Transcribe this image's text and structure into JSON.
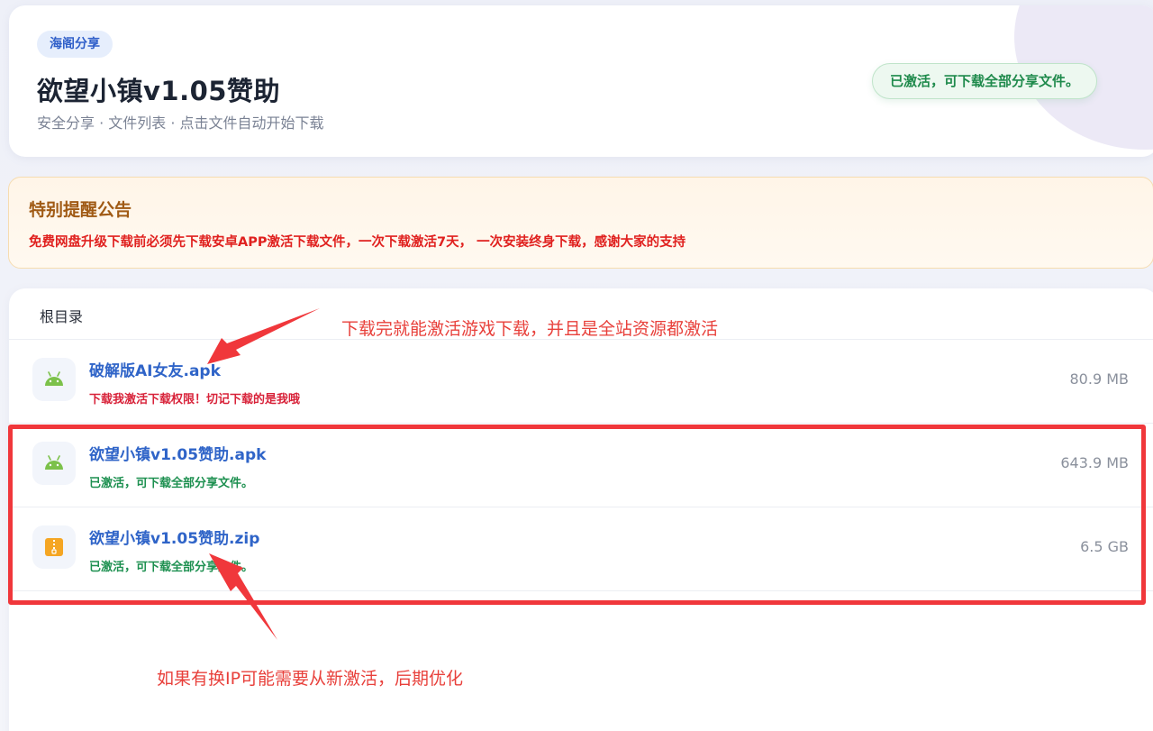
{
  "header": {
    "brand_tag": "海阁分享",
    "title": "欲望小镇v1.05赞助",
    "subtitle": "安全分享 · 文件列表 · 点击文件自动开始下载",
    "status": "已激活，可下载全部分享文件。"
  },
  "notice": {
    "title": "特别提醒公告",
    "text": "免费网盘升级下载前必须先下载安卓APP激活下载文件，一次下载激活7天， 一次安装终身下载，感谢大家的支持"
  },
  "files": {
    "root_label": "根目录",
    "items": [
      {
        "name": "破解版AI女友.apk",
        "note": "下载我激活下载权限！切记下载的是我哦",
        "size": "80.9 MB",
        "icon": "android-icon",
        "note_color": "red"
      },
      {
        "name": "欲望小镇v1.05赞助.apk",
        "note": "已激活，可下载全部分享文件。",
        "size": "643.9 MB",
        "icon": "android-icon",
        "note_color": "green"
      },
      {
        "name": "欲望小镇v1.05赞助.zip",
        "note": "已激活，可下载全部分享文件。",
        "size": "6.5 GB",
        "icon": "zip-icon",
        "note_color": "green"
      }
    ]
  },
  "annotations": {
    "top": "下载完就能激活游戏下载，并且是全站资源都激活",
    "bottom": "如果有换IP可能需要从新激活，后期优化"
  },
  "colors": {
    "annotation": "#e8403b",
    "link": "#2f64c8",
    "active_green": "#1d9050",
    "warning_red": "#d8233a"
  }
}
